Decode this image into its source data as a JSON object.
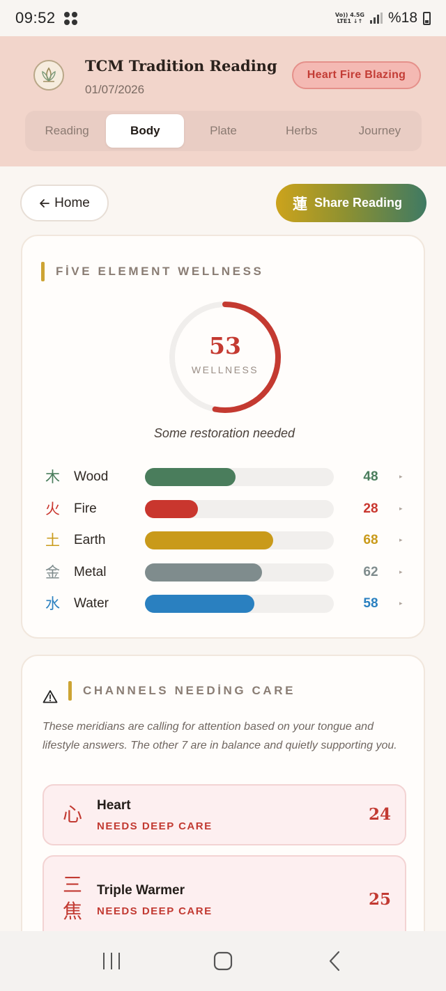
{
  "status_bar": {
    "time": "09:52",
    "network_top": "Vo))  4.5G",
    "network_bottom": "LTE1 ↓↑",
    "battery": "%18"
  },
  "header": {
    "title": "TCM Tradition Reading",
    "date": "01/07/2026",
    "status_pill": "Heart Fire Blazing",
    "tabs": [
      "Reading",
      "Body",
      "Plate",
      "Herbs",
      "Journey"
    ],
    "active_tab": "Body"
  },
  "actions": {
    "home_label": "Home",
    "share_label": "Share Reading",
    "share_glyph": "蓮"
  },
  "wellness": {
    "heading": "FİVE ELEMENT WELLNESS",
    "score": "53",
    "score_fraction": 0.53,
    "score_label": "WELLNESS",
    "caption": "Some restoration needed",
    "elements": [
      {
        "char": "木",
        "name": "Wood",
        "value": 48,
        "color": "#4a7d5c"
      },
      {
        "char": "火",
        "name": "Fire",
        "value": 28,
        "color": "#c9362e"
      },
      {
        "char": "土",
        "name": "Earth",
        "value": 68,
        "color": "#c99a1a"
      },
      {
        "char": "金",
        "name": "Metal",
        "value": 62,
        "color": "#7f8c8d"
      },
      {
        "char": "水",
        "name": "Water",
        "value": 58,
        "color": "#2a80c0"
      }
    ]
  },
  "channels": {
    "heading": "CHANNELS NEEDİNG CARE",
    "description": "These meridians are calling for attention based on your tongue and lifestyle answers. The other 7 are in balance and quietly supporting you.",
    "items": [
      {
        "char": "心",
        "name": "Heart",
        "status": "NEEDS DEEP CARE",
        "score": "24"
      },
      {
        "char": "三\n焦",
        "name": "Triple Warmer",
        "status": "NEEDS DEEP CARE",
        "score": "25"
      }
    ]
  },
  "colors": {
    "accent_red": "#c43a31",
    "header_bg": "#f2d5cb",
    "gold": "#cda434"
  }
}
